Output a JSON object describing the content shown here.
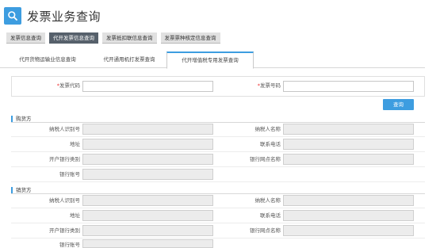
{
  "header": {
    "icon": "search-icon",
    "title": "发票业务查询",
    "accent": "#3d9de0"
  },
  "main_tabs": [
    {
      "label": "发票信息查询"
    },
    {
      "label": "代开发票信息查询"
    },
    {
      "label": "发票抵扣联信息查询"
    },
    {
      "label": "发票票种核定信息查询"
    }
  ],
  "sub_tabs": [
    {
      "label": "代开货物运输业信息查询"
    },
    {
      "label": "代开通用机打发票查询"
    },
    {
      "label": "代开增值税专用发票查询"
    }
  ],
  "search": {
    "code_required": "*",
    "code_label": "发票代码",
    "code_value": "",
    "number_required": "*",
    "number_label": "发票号码",
    "number_value": "",
    "query_button": "查询"
  },
  "buyer": {
    "title": "购货方",
    "taxpayer_id_label": "纳税人识别号",
    "taxpayer_name_label": "纳税人名称",
    "address_label": "地址",
    "phone_label": "联系电话",
    "bank_category_label": "开户银行类别",
    "bank_branch_label": "银行网点名称",
    "bank_account_label": "银行账号"
  },
  "seller": {
    "title": "销货方",
    "taxpayer_id_label": "纳税人识别号",
    "taxpayer_name_label": "纳税人名称",
    "address_label": "地址",
    "phone_label": "联系电话",
    "bank_category_label": "开户银行类别",
    "bank_branch_label": "银行网点名称",
    "bank_account_label": "银行账号"
  }
}
